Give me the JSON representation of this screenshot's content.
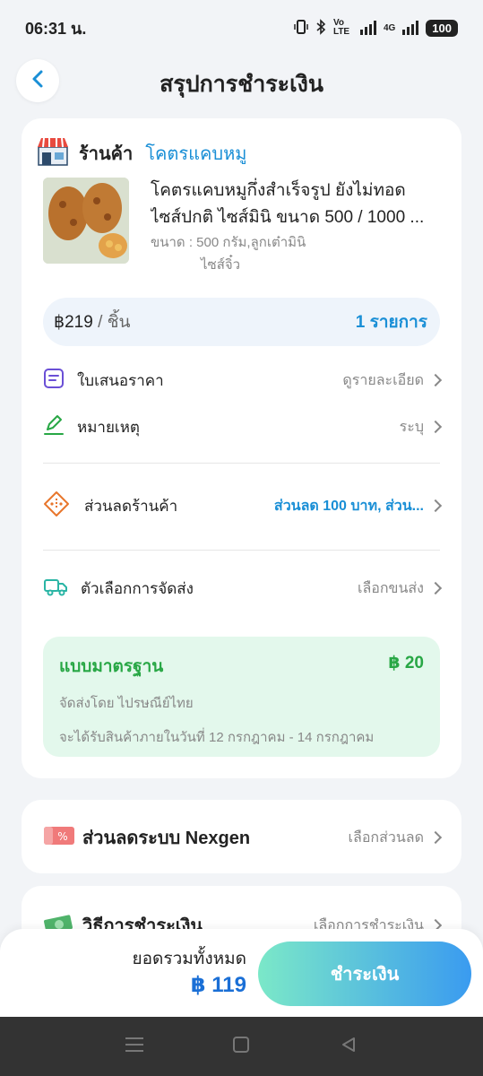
{
  "status": {
    "time": "06:31 น.",
    "network_label": "Vo LTE",
    "network_4g": "4G",
    "battery": "100"
  },
  "header": {
    "title": "สรุปการชำระเงิน"
  },
  "shop": {
    "label": "ร้านค้า",
    "name": "โคตรแคบหมู"
  },
  "product": {
    "title_line1": "โคตรแคบหมูกึ่งสำเร็จรูป ยังไม่ทอด",
    "title_line2": "ไซส์ปกติ ไซส์มินิ ขนาด 500 / 1000 ...",
    "variant_line1": "ขนาด : 500 กรัม,ลูกเต๋ามินิ",
    "variant_line2": "ไซส์จิ๋ว",
    "price": "฿219",
    "price_unit": " / ชิ้น",
    "quantity": "1 รายการ"
  },
  "rows": {
    "quote_label": "ใบเสนอราคา",
    "quote_value": "ดูรายละเอียด",
    "note_label": "หมายเหตุ",
    "note_value": "ระบุ",
    "shop_discount_label": "ส่วนลดร้านค้า",
    "shop_discount_value": "ส่วนลด 100 บาท, ส่วน...",
    "shipping_label": "ตัวเลือกการจัดส่ง",
    "shipping_value": "เลือกขนส่ง"
  },
  "shipping_option": {
    "title": "แบบมาตรฐาน",
    "price": "฿ 20",
    "carrier": "จัดส่งโดย ไปรษณีย์ไทย",
    "eta": "จะได้รับสินค้าภายในวันที่ 12 กรกฎาคม - 14 กรกฎาคม"
  },
  "system_discount": {
    "title": "ส่วนลดระบบ Nexgen",
    "value": "เลือกส่วนลด"
  },
  "payment": {
    "title": "วิธีการชำระเงิน",
    "value": "เลือกการชำระเงิน"
  },
  "footer": {
    "total_label": "ยอดรวมทั้งหมด",
    "total_value": "฿ 119",
    "pay_button": "ชำระเงิน"
  },
  "colors": {
    "accent_blue": "#1a8fd6",
    "success_green": "#28a745",
    "shipping_bg": "#e3f8ec",
    "price_pill_bg": "#eef4fb"
  }
}
